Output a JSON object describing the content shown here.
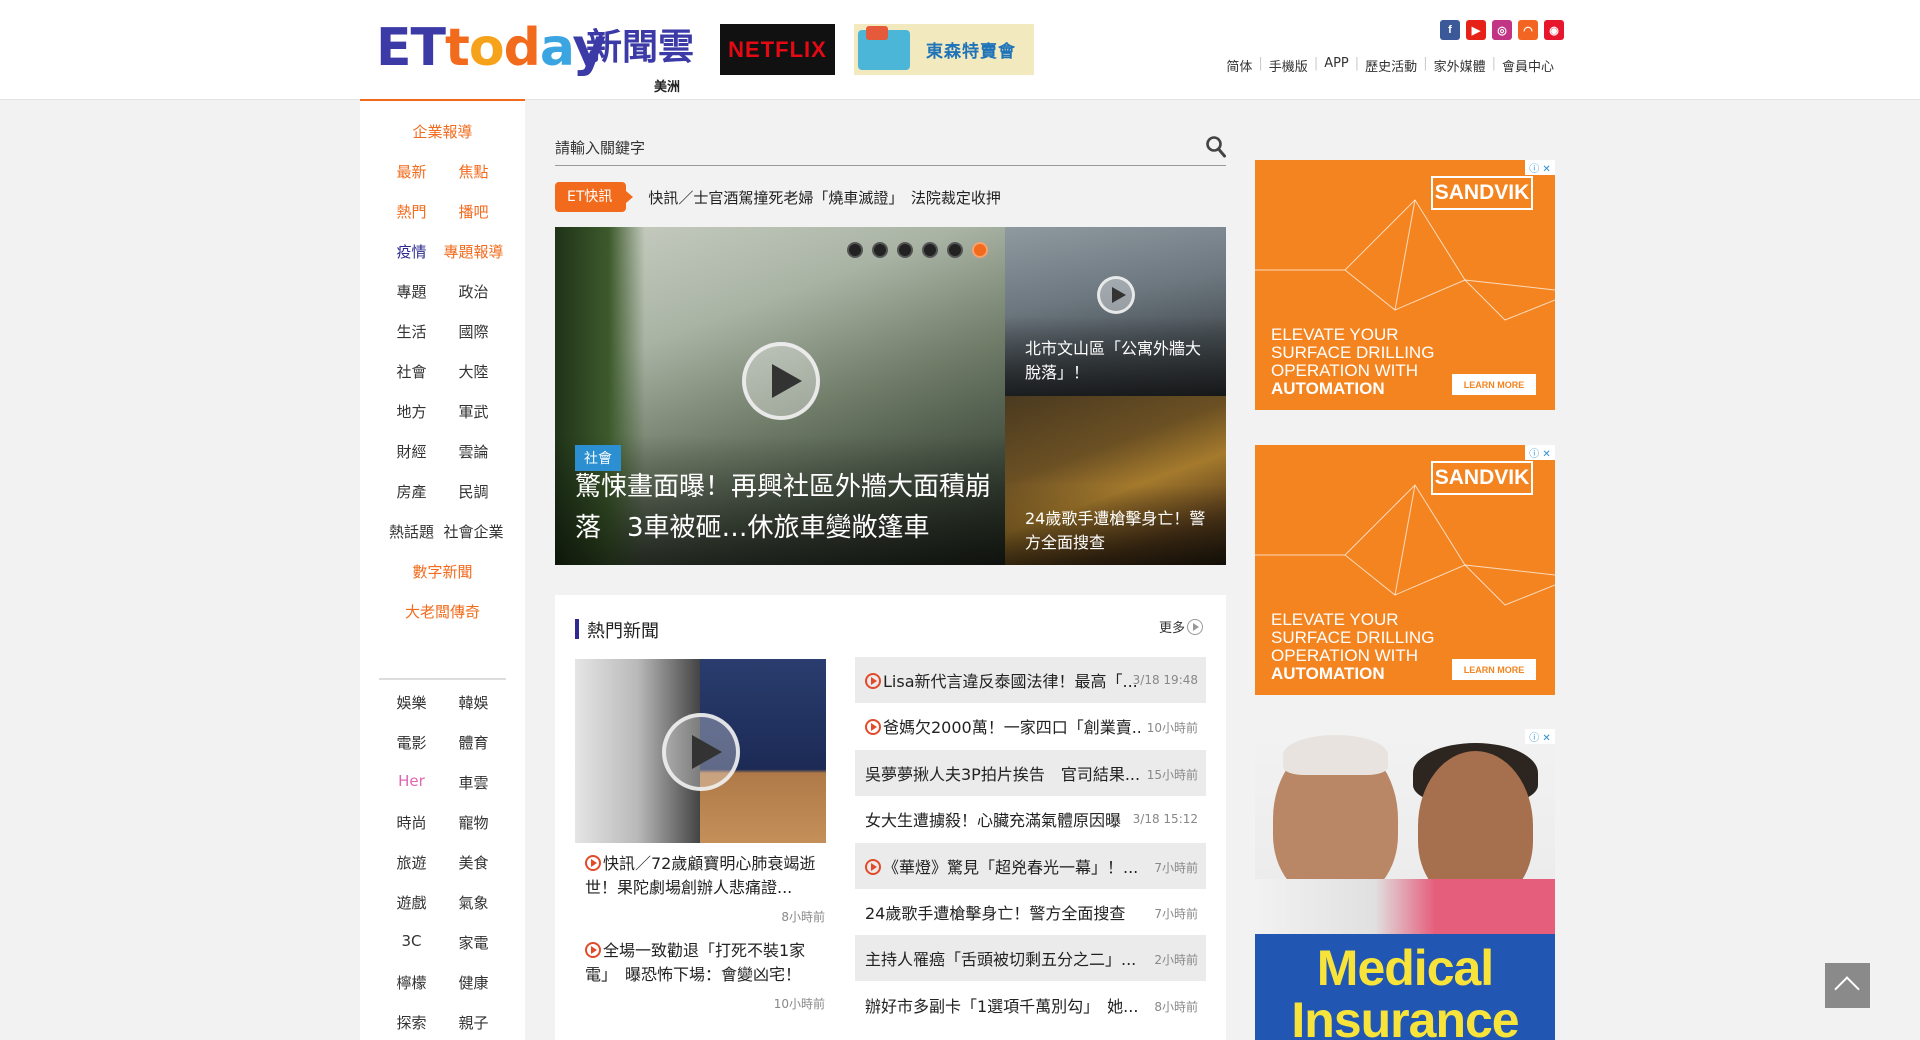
{
  "header": {
    "logo_parts": [
      "ET",
      "t",
      "o",
      "d",
      "a",
      "y"
    ],
    "logo_cn": "新聞雲",
    "edition": "美洲",
    "ad_netflix": "NETFLIX",
    "ad_sale": "東森特賣會",
    "social": [
      {
        "icon": "facebook-icon",
        "glyph": "f",
        "color": "#3b5998"
      },
      {
        "icon": "youtube-icon",
        "glyph": "▶",
        "color": "#e62117"
      },
      {
        "icon": "instagram-icon",
        "glyph": "◎",
        "color": "#c13584"
      },
      {
        "icon": "rss-icon",
        "glyph": "◠",
        "color": "#f26522"
      },
      {
        "icon": "weibo-icon",
        "glyph": "◉",
        "color": "#e6162d"
      }
    ],
    "topnav": [
      "简体",
      "手機版",
      "APP",
      "歷史活動",
      "家外媒體",
      "會員中心"
    ]
  },
  "leftnav": {
    "rows": [
      [
        "企業報導"
      ],
      [
        "最新",
        "焦點"
      ],
      [
        "熱門",
        "播吧"
      ],
      [
        "疫情",
        "專題報導"
      ],
      [
        "專題",
        "政治"
      ],
      [
        "生活",
        "國際"
      ],
      [
        "社會",
        "大陸"
      ],
      [
        "地方",
        "軍武"
      ],
      [
        "財經",
        "雲論"
      ],
      [
        "房產",
        "民調"
      ],
      [
        "熱話題",
        "社會企業"
      ],
      [
        "數字新聞"
      ],
      [
        "大老闆傳奇"
      ],
      [
        "娛樂",
        "韓娛"
      ],
      [
        "電影",
        "體育"
      ],
      [
        "Her",
        "車雲"
      ],
      [
        "時尚",
        "寵物"
      ],
      [
        "旅遊",
        "美食"
      ],
      [
        "遊戲",
        "氣象"
      ],
      [
        "3C",
        "家電"
      ],
      [
        "檸檬",
        "健康"
      ],
      [
        "探索",
        "親子"
      ]
    ],
    "colors": {
      "orange": "#f26b1d",
      "navy": "#2d2b8f",
      "pink": "#e066b0",
      "text": "#333333"
    }
  },
  "search": {
    "placeholder": "請輸入關鍵字"
  },
  "ticker": {
    "badge": "ET快訊",
    "text": "快訊／士官酒駕撞死老婦「燒車滅證」　法院裁定收押"
  },
  "hero": {
    "tag": "社會",
    "title": "驚悚畫面曝！再興社區外牆大面積崩落　3車被砸…休旅車變敞篷車",
    "slide_count": 6,
    "active_slide": 6
  },
  "side_stories": [
    {
      "title": "北市文山區「公寓外牆大脫落」！"
    },
    {
      "title": "24歲歌手遭槍擊身亡！警方全面搜查"
    }
  ],
  "hot_news": {
    "title": "熱門新聞",
    "more": "更多",
    "lead": [
      {
        "title": "快訊／72歲顧寶明心肺衰竭逝世！果陀劇場創辦人悲痛證...",
        "time": "8小時前"
      },
      {
        "title": "全場一致勸退「打死不裝1家電」　曝恐怖下場：會變凶宅！",
        "time": "10小時前"
      }
    ],
    "list": [
      {
        "title": "Lisa新代言違反泰國法律！最高「...",
        "time": "3/18 19:48",
        "video": true
      },
      {
        "title": "爸媽欠2000萬！一家四口「創業賣...",
        "time": "10小時前",
        "video": true
      },
      {
        "title": "吳夢夢揪人夫3P拍片挨告　官司結果...",
        "time": "15小時前",
        "video": false
      },
      {
        "title": "女大生遭擄殺！心臟充滿氣體原因曝",
        "time": "3/18 15:12",
        "video": false
      },
      {
        "title": "《華燈》驚見「超兇春光一幕」！...",
        "time": "7小時前",
        "video": true
      },
      {
        "title": "24歲歌手遭槍擊身亡！警方全面搜查",
        "time": "7小時前",
        "video": false
      },
      {
        "title": "主持人罹癌「舌頭被切剩五分之二」...",
        "time": "2小時前",
        "video": false
      },
      {
        "title": "辦好市多副卡「1選項千萬別勾」　她...",
        "time": "8小時前",
        "video": false
      }
    ]
  },
  "ads": {
    "sandvik": {
      "brand": "SANDVIK",
      "line1": "ELEVATE YOUR",
      "line2": "SURFACE DRILLING",
      "line3": "OPERATION WITH",
      "line4": "AUTOMATION",
      "cta": "LEARN MORE"
    },
    "insurance": {
      "headline": "Medical Insurance"
    },
    "ad_choices": "ⓘ ✕"
  }
}
